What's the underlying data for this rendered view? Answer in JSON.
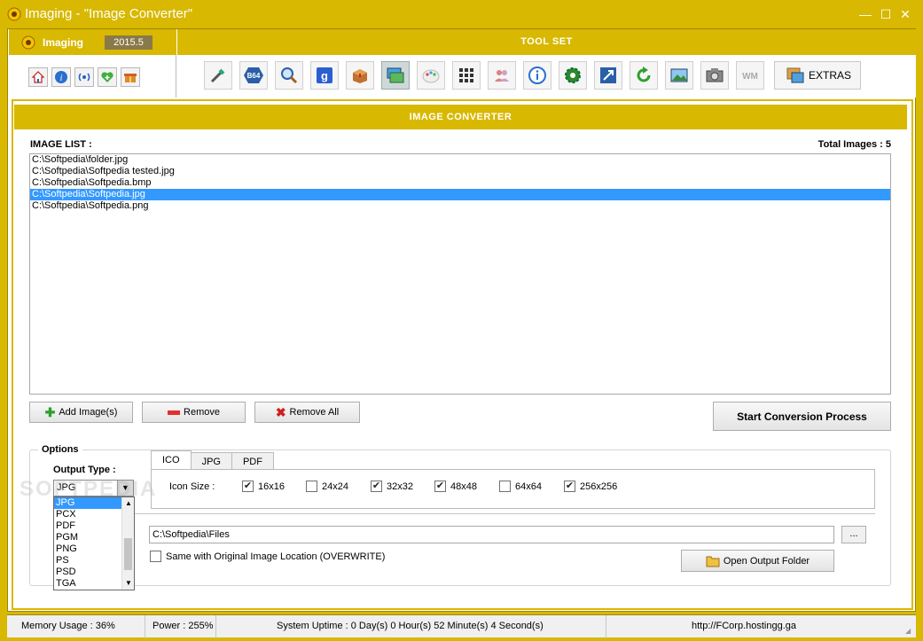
{
  "window": {
    "title": "Imaging - \"Image Converter\"",
    "controls": {
      "minimize": "—",
      "maximize": "☐",
      "close": "✕"
    }
  },
  "brand": {
    "name": "Imaging",
    "version": "2015.5"
  },
  "toolset": {
    "title": "TOOL SET",
    "extras_label": "EXTRAS",
    "wm_label": "WM",
    "b64_label": "B64",
    "g_label": "g"
  },
  "converter": {
    "title": "IMAGE CONVERTER"
  },
  "image_list": {
    "label": "IMAGE LIST :",
    "total": "Total Images : 5",
    "items": [
      "C:\\Softpedia\\folder.jpg",
      "C:\\Softpedia\\Softpedia tested.jpg",
      "C:\\Softpedia\\Softpedia.bmp",
      "C:\\Softpedia\\Softpedia.jpg",
      "C:\\Softpedia\\Softpedia.png"
    ],
    "selected_index": 3
  },
  "buttons": {
    "add": "Add Image(s)",
    "remove": "Remove",
    "remove_all": "Remove All",
    "start": "Start Conversion Process",
    "browse": "...",
    "open_folder": "Open Output Folder"
  },
  "options": {
    "title": "Options",
    "output_type_label": "Output Type :",
    "output_type_value": "JPG",
    "dropdown_options": [
      "JPG",
      "PCX",
      "PDF",
      "PGM",
      "PNG",
      "PS",
      "PSD",
      "TGA"
    ],
    "tabs": [
      "ICO",
      "JPG",
      "PDF"
    ],
    "icon_size_label": "Icon Size :",
    "icon_sizes": [
      {
        "label": "16x16",
        "checked": true
      },
      {
        "label": "24x24",
        "checked": false
      },
      {
        "label": "32x32",
        "checked": true
      },
      {
        "label": "48x48",
        "checked": true
      },
      {
        "label": "64x64",
        "checked": false
      },
      {
        "label": "256x256",
        "checked": true
      }
    ],
    "output_path": "C:\\Softpedia\\Files",
    "overwrite_label": "Same with Original Image Location (OVERWRITE)"
  },
  "status": {
    "memory": "Memory Usage : 36%",
    "power": "Power : 255%",
    "uptime": "System Uptime : 0 Day(s) 0 Hour(s) 52 Minute(s) 4 Second(s)",
    "url": "http://FCorp.hostingg.ga"
  },
  "watermark": "SOFTPEDIA",
  "colors": {
    "accent": "#d8b800",
    "selection": "#3399ff"
  }
}
